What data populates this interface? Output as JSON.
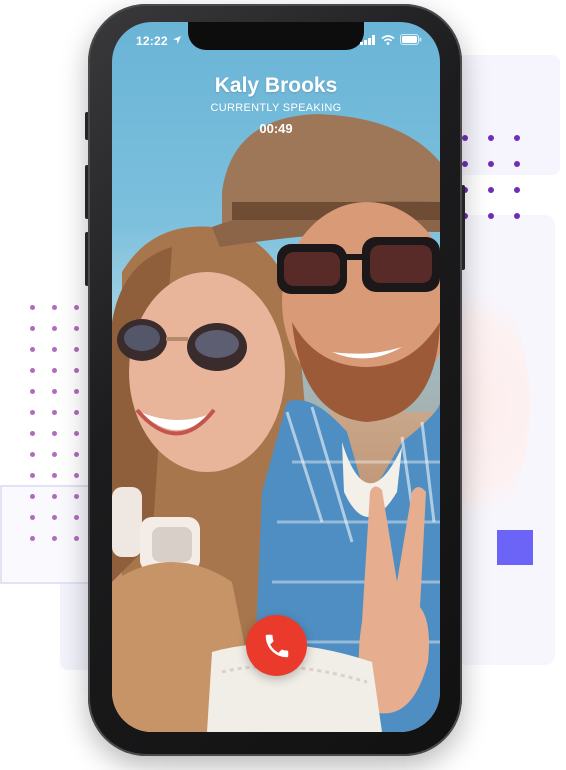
{
  "status_bar": {
    "time": "12:22"
  },
  "call": {
    "caller_name": "Kaly Brooks",
    "status": "CURRENTLY SPEAKING",
    "duration": "00:49"
  },
  "icons": {
    "location": "location-arrow-icon",
    "signal": "cellular-signal-icon",
    "wifi": "wifi-icon",
    "battery": "battery-icon",
    "end_call": "phone-hangup-icon"
  },
  "colors": {
    "end_call_button": "#ea3a2b",
    "accent_square": "#6c63f7",
    "dot_purple": "#6f2fb5"
  }
}
